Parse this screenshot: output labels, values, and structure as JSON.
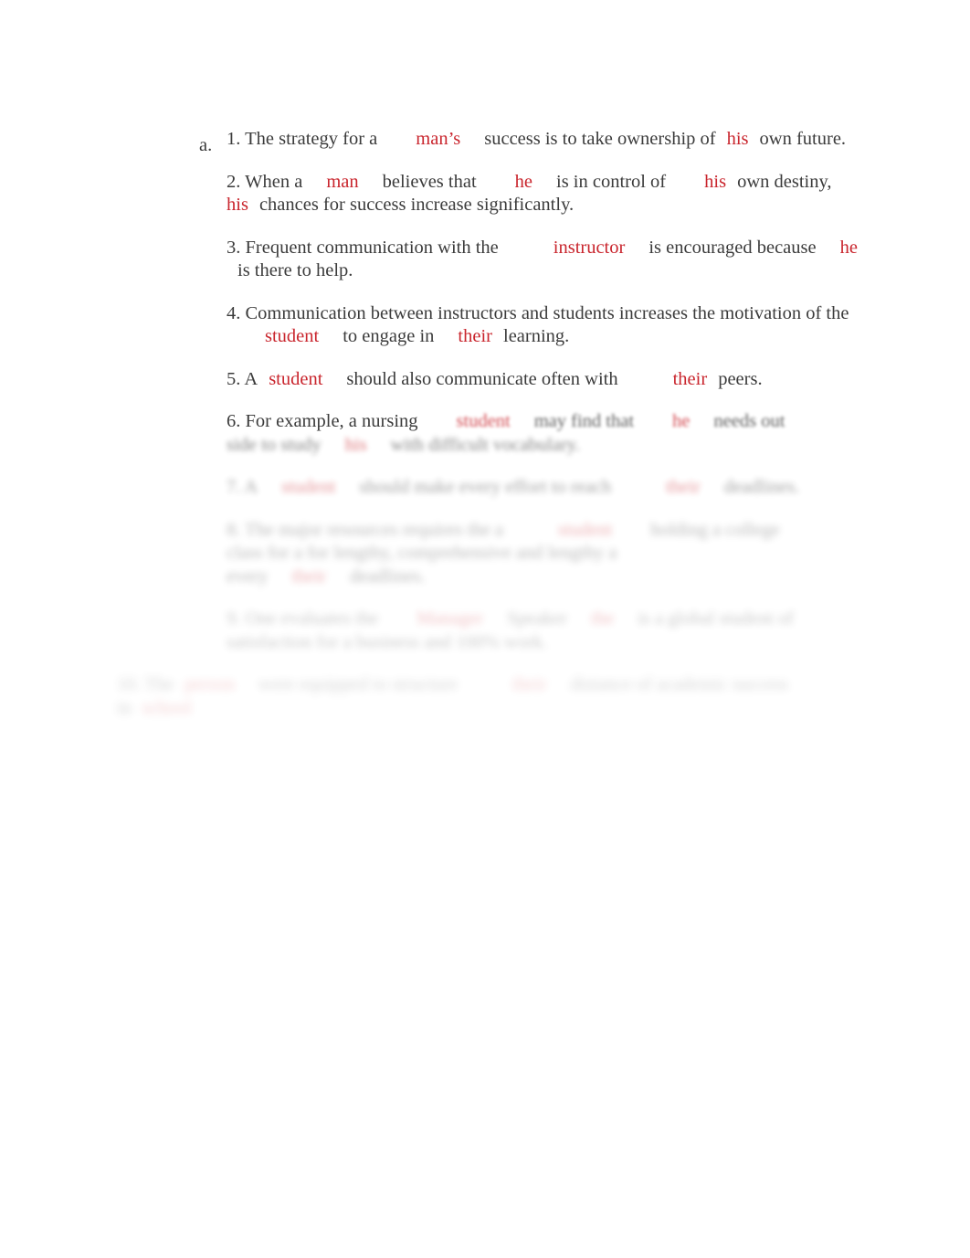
{
  "document": {
    "list_marker": "a.",
    "accent_red": "#c9252d",
    "text_color": "#3b3b3b",
    "background": "#ffffff",
    "items": [
      {
        "number": "1.",
        "blur_level": 0,
        "segments": [
          {
            "text": "1. The strategy for a",
            "color": "black",
            "space_after": "large"
          },
          {
            "text": "man’s",
            "color": "red",
            "space_after": "medium"
          },
          {
            "text": "success is to take ownership of",
            "color": "black",
            "space_after": "small"
          },
          {
            "text": "his",
            "color": "red",
            "space_after": "small"
          },
          {
            "text": "own future.",
            "color": "black",
            "space_after": "none"
          }
        ],
        "plain": "1. The strategy for a   man’s   success is to take ownership of  his  own future."
      },
      {
        "number": "2.",
        "blur_level": 0,
        "segments": [
          {
            "text": "2. When a",
            "color": "black",
            "space_after": "medium"
          },
          {
            "text": "man",
            "color": "red",
            "space_after": "medium"
          },
          {
            "text": "believes that",
            "color": "black",
            "space_after": "large"
          },
          {
            "text": "he",
            "color": "red",
            "space_after": "medium"
          },
          {
            "text": "is in control of",
            "color": "black",
            "space_after": "large"
          },
          {
            "text": "his",
            "color": "red",
            "space_after": "small"
          },
          {
            "text": "own destiny,",
            "color": "black",
            "space_after": "medium"
          },
          {
            "text": "his",
            "color": "red",
            "space_after": "small"
          },
          {
            "text": "chances for success increase significantly.",
            "color": "black",
            "space_after": "none"
          }
        ],
        "plain": "2. When a   man   believes that   he   is in control of   his  own destiny,   his  chances for success increase significantly."
      },
      {
        "number": "3.",
        "blur_level": 0,
        "segments": [
          {
            "text": "3. Frequent communication with the",
            "color": "black",
            "space_after": "xlarge"
          },
          {
            "text": "instructor",
            "color": "red",
            "space_after": "medium"
          },
          {
            "text": "is encouraged because",
            "color": "black",
            "space_after": "medium"
          },
          {
            "text": "he",
            "color": "red",
            "space_after": "small"
          },
          {
            "text": "is there to help.",
            "color": "black",
            "space_after": "none"
          }
        ],
        "plain": "3. Frequent communication with the    instructor   is encouraged because   he  is there to help."
      },
      {
        "number": "4.",
        "blur_level": 0,
        "segments": [
          {
            "text": "4. Communication between instructors and students increases the motivation of the",
            "color": "black",
            "space_after": "large"
          },
          {
            "text": "student",
            "color": "red",
            "space_after": "medium"
          },
          {
            "text": "to engage in",
            "color": "black",
            "space_after": "medium"
          },
          {
            "text": "their",
            "color": "red",
            "space_after": "small"
          },
          {
            "text": "learning.",
            "color": "black",
            "space_after": "none"
          }
        ],
        "plain": "4. Communication between instructors and students increases the motivation of the   student   to engage in   their  learning."
      },
      {
        "number": "5.",
        "blur_level": 0,
        "segments": [
          {
            "text": "5. A",
            "color": "black",
            "space_after": "small"
          },
          {
            "text": "student",
            "color": "red",
            "space_after": "medium"
          },
          {
            "text": "should also communicate often with",
            "color": "black",
            "space_after": "xlarge"
          },
          {
            "text": "their",
            "color": "red",
            "space_after": "small"
          },
          {
            "text": "peers.",
            "color": "black",
            "space_after": "none"
          }
        ],
        "plain": "5. A  student   should also communicate often with     their  peers."
      },
      {
        "number": "6.",
        "blur_level": 2,
        "visible_prefix": "6. For example, a nursing",
        "segments": [
          {
            "text": "6. For example, a nursing",
            "color": "black",
            "space_after": "large"
          },
          {
            "text": "student",
            "color": "red",
            "space_after": "medium"
          },
          {
            "text": "may find that",
            "color": "black",
            "space_after": "large"
          },
          {
            "text": "he",
            "color": "red",
            "space_after": "medium"
          },
          {
            "text": "needs out",
            "color": "black",
            "space_after": "none"
          }
        ],
        "second_line": [
          {
            "text": "side to study",
            "color": "black",
            "space_after": "medium"
          },
          {
            "text": "his",
            "color": "red",
            "space_after": "medium"
          },
          {
            "text": "with difficult vocabulary.",
            "color": "black",
            "space_after": "none"
          }
        ]
      },
      {
        "number": "7.",
        "blur_level": 4,
        "segments": [
          {
            "text": "7. A",
            "color": "black",
            "space_after": "medium"
          },
          {
            "text": "student",
            "color": "red",
            "space_after": "medium"
          },
          {
            "text": "should make every effort to reach",
            "color": "black",
            "space_after": "xlarge"
          },
          {
            "text": "their",
            "color": "red",
            "space_after": "medium"
          },
          {
            "text": "deadlines.",
            "color": "black",
            "space_after": "none"
          }
        ]
      },
      {
        "number": "8.",
        "blur_level": 5,
        "segments": [
          {
            "text": "8. The major resources requires the a",
            "color": "black",
            "space_after": "xlarge"
          },
          {
            "text": "student",
            "color": "red",
            "space_after": "large"
          },
          {
            "text": "holding a college",
            "color": "black",
            "space_after": "none"
          }
        ],
        "second_line": [
          {
            "text": "class for a for lengthy, comprehensive and lengthy a",
            "color": "black",
            "space_after": "none"
          }
        ],
        "third_line": [
          {
            "text": "every",
            "color": "black",
            "space_after": "medium"
          },
          {
            "text": "their",
            "color": "red",
            "space_after": "medium"
          },
          {
            "text": "deadlines.",
            "color": "black",
            "space_after": "none"
          }
        ]
      },
      {
        "number": "9.",
        "blur_level": 6,
        "segments": [
          {
            "text": "9. One evaluates the",
            "color": "black",
            "space_after": "large"
          },
          {
            "text": "Manager",
            "color": "red",
            "space_after": "medium"
          },
          {
            "text": "Speaker",
            "color": "black",
            "space_after": "medium"
          },
          {
            "text": "the",
            "color": "red",
            "space_after": "medium"
          },
          {
            "text": "is a global student of",
            "color": "black",
            "space_after": "none"
          }
        ],
        "second_line": [
          {
            "text": "satisfaction for a business and 100% work.",
            "color": "black",
            "space_after": "none"
          }
        ]
      },
      {
        "number": "10.",
        "blur_level": 7,
        "segments": [
          {
            "text": "10. The",
            "color": "black",
            "space_after": "small"
          },
          {
            "text": "person",
            "color": "red",
            "space_after": "medium"
          },
          {
            "text": "were equipped to structure",
            "color": "black",
            "space_after": "xlarge"
          },
          {
            "text": "their",
            "color": "red",
            "space_after": "medium"
          },
          {
            "text": "distance of academic success",
            "color": "black",
            "space_after": "none"
          }
        ],
        "second_line": [
          {
            "text": "in",
            "color": "black",
            "space_after": "small"
          },
          {
            "text": "school",
            "color": "red",
            "space_after": "none"
          }
        ]
      }
    ]
  }
}
